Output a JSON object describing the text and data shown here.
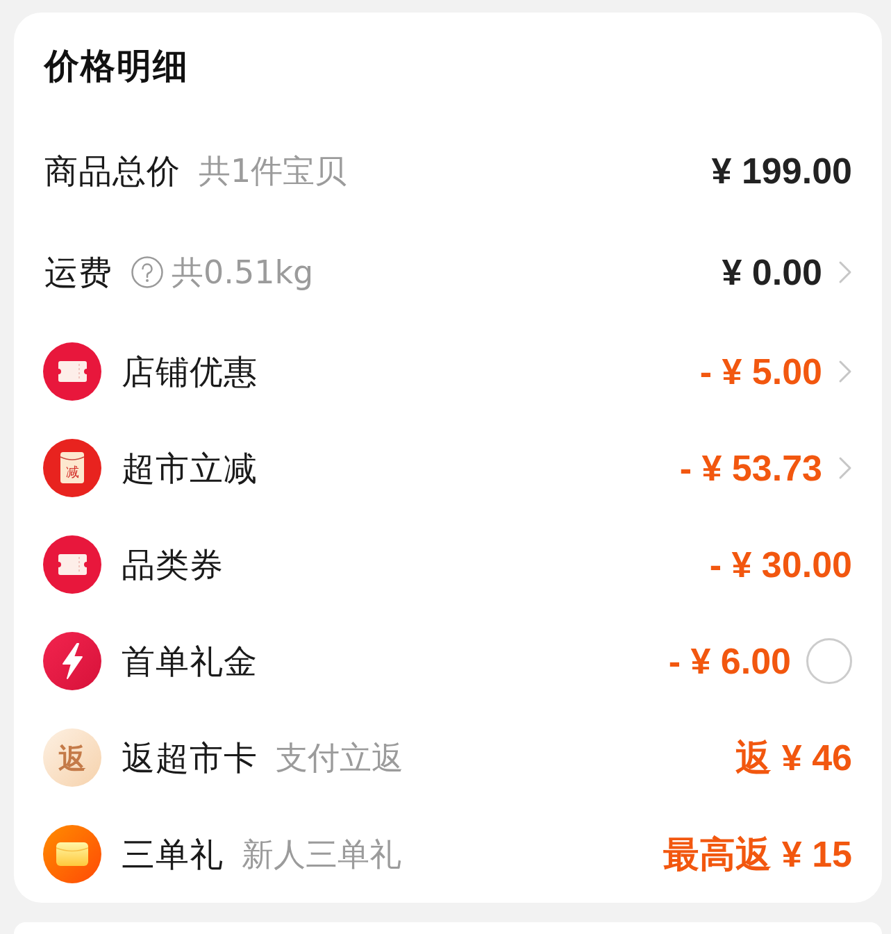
{
  "title": "价格明细",
  "rows": [
    {
      "kind": "plain",
      "label": "商品总价",
      "note": "共1件宝贝",
      "amount": "¥ 199.00",
      "highlight": false
    },
    {
      "kind": "plain",
      "label": "运费",
      "help": true,
      "note": "共0.51kg",
      "amount": "¥ 0.00",
      "highlight": false,
      "chevron": true
    },
    {
      "kind": "coupon",
      "label": "店铺优惠",
      "amount": "- ¥ 5.00",
      "highlight": true,
      "chevron": true
    },
    {
      "kind": "reduction",
      "badge_text": "减",
      "label": "超市立减",
      "amount": "- ¥ 53.73",
      "highlight": true,
      "chevron": true
    },
    {
      "kind": "coupon",
      "label": "品类券",
      "amount": "- ¥ 30.00",
      "highlight": true
    },
    {
      "kind": "bolt",
      "label": "首单礼金",
      "amount": "- ¥ 6.00",
      "highlight": true,
      "checked": false
    },
    {
      "kind": "rebate",
      "badge_text": "返",
      "label": "返超市卡",
      "note": "支付立返",
      "amount": "返 ¥ 46",
      "highlight": true
    },
    {
      "kind": "gift",
      "label": "三单礼",
      "note": "新人三单礼",
      "amount": "最高返 ¥ 15",
      "highlight": true
    }
  ]
}
